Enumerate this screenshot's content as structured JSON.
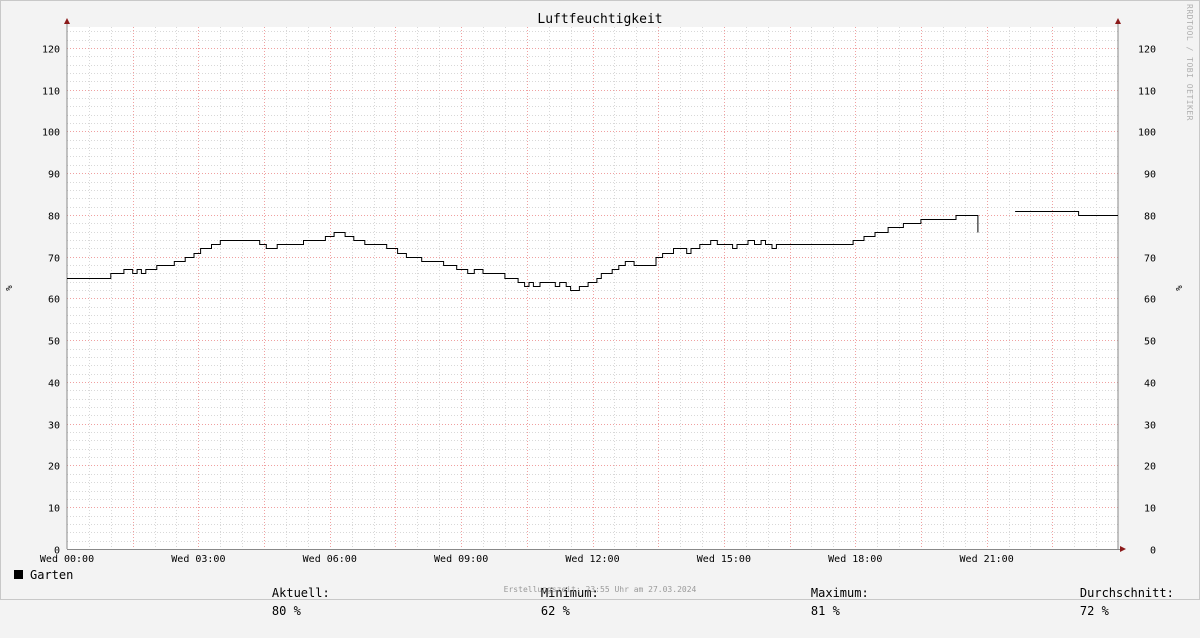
{
  "chart_data": {
    "type": "line",
    "title": "Luftfeuchtigkeit",
    "ylabel": "%",
    "ylim": [
      0,
      125
    ],
    "yticks": [
      0,
      10,
      20,
      30,
      40,
      50,
      60,
      70,
      80,
      90,
      100,
      110,
      120
    ],
    "xlim_hours": [
      0,
      24
    ],
    "xticks": [
      {
        "hour": 0,
        "label": "Wed 00:00"
      },
      {
        "hour": 3,
        "label": "Wed 03:00"
      },
      {
        "hour": 6,
        "label": "Wed 06:00"
      },
      {
        "hour": 9,
        "label": "Wed 09:00"
      },
      {
        "hour": 12,
        "label": "Wed 12:00"
      },
      {
        "hour": 15,
        "label": "Wed 15:00"
      },
      {
        "hour": 18,
        "label": "Wed 18:00"
      },
      {
        "hour": 21,
        "label": "Wed 21:00"
      }
    ],
    "grid": true,
    "legend_placement": "bottom-left",
    "series": [
      {
        "name": "Garten",
        "color": "#000000",
        "segments": [
          [
            [
              0.0,
              65
            ],
            [
              1.0,
              66
            ],
            [
              1.3,
              67
            ],
            [
              1.5,
              66
            ],
            [
              1.6,
              67
            ],
            [
              1.7,
              66
            ],
            [
              1.8,
              67
            ],
            [
              2.05,
              68
            ],
            [
              2.45,
              69
            ],
            [
              2.7,
              70
            ],
            [
              2.9,
              71
            ],
            [
              3.05,
              72
            ],
            [
              3.3,
              73
            ],
            [
              3.5,
              74
            ],
            [
              4.4,
              73
            ],
            [
              4.55,
              72
            ],
            [
              4.8,
              73
            ],
            [
              5.4,
              74
            ],
            [
              5.9,
              75
            ],
            [
              6.1,
              76
            ],
            [
              6.35,
              75
            ],
            [
              6.55,
              74
            ],
            [
              6.8,
              73
            ],
            [
              7.3,
              72
            ],
            [
              7.55,
              71
            ],
            [
              7.75,
              70
            ],
            [
              8.1,
              69
            ],
            [
              8.6,
              68
            ],
            [
              8.9,
              67
            ],
            [
              9.15,
              66
            ],
            [
              9.3,
              67
            ],
            [
              9.5,
              66
            ],
            [
              10.0,
              65
            ],
            [
              10.3,
              64
            ],
            [
              10.45,
              63
            ],
            [
              10.55,
              64
            ],
            [
              10.65,
              63
            ],
            [
              10.8,
              64
            ],
            [
              11.15,
              63
            ],
            [
              11.25,
              64
            ],
            [
              11.4,
              63
            ],
            [
              11.5,
              62
            ],
            [
              11.7,
              63
            ],
            [
              11.9,
              64
            ],
            [
              12.1,
              65
            ],
            [
              12.2,
              66
            ],
            [
              12.45,
              67
            ],
            [
              12.6,
              68
            ],
            [
              12.75,
              69
            ],
            [
              12.95,
              68
            ],
            [
              13.45,
              70
            ],
            [
              13.6,
              71
            ],
            [
              13.85,
              72
            ],
            [
              14.15,
              71
            ],
            [
              14.25,
              72
            ],
            [
              14.45,
              73
            ],
            [
              14.7,
              74
            ],
            [
              14.85,
              73
            ],
            [
              15.2,
              72
            ],
            [
              15.3,
              73
            ],
            [
              15.55,
              74
            ],
            [
              15.7,
              73
            ],
            [
              15.85,
              74
            ],
            [
              15.95,
              73
            ],
            [
              16.1,
              72
            ],
            [
              16.2,
              73
            ],
            [
              17.95,
              74
            ],
            [
              18.2,
              75
            ],
            [
              18.45,
              76
            ],
            [
              18.75,
              77
            ],
            [
              19.1,
              78
            ],
            [
              19.5,
              79
            ],
            [
              20.3,
              80
            ],
            [
              20.8,
              76
            ]
          ],
          [
            [
              21.65,
              81
            ],
            [
              23.1,
              80
            ],
            [
              24.0,
              80
            ]
          ]
        ]
      }
    ],
    "legend": {
      "series_name": "Garten",
      "current_label": "Aktuell:",
      "current_value": "80 %",
      "min_label": "Minimum:",
      "min_value": "62 %",
      "max_label": "Maximum:",
      "max_value": "81 %",
      "avg_label": "Durchschnitt:",
      "avg_value": "72 %"
    },
    "footer": "Erstellungszeit: 23:55 Uhr am 27.03.2024",
    "watermark": "RRDTOOL / TOBI OETIKER",
    "colors": {
      "background": "#f3f3f3",
      "canvas": "#ffffff",
      "grid_minor": "#d8d8d8",
      "grid_major": "#f0a0a0",
      "axis": "#888888",
      "arrow": "#8b1a1a",
      "line": "#000000"
    }
  }
}
